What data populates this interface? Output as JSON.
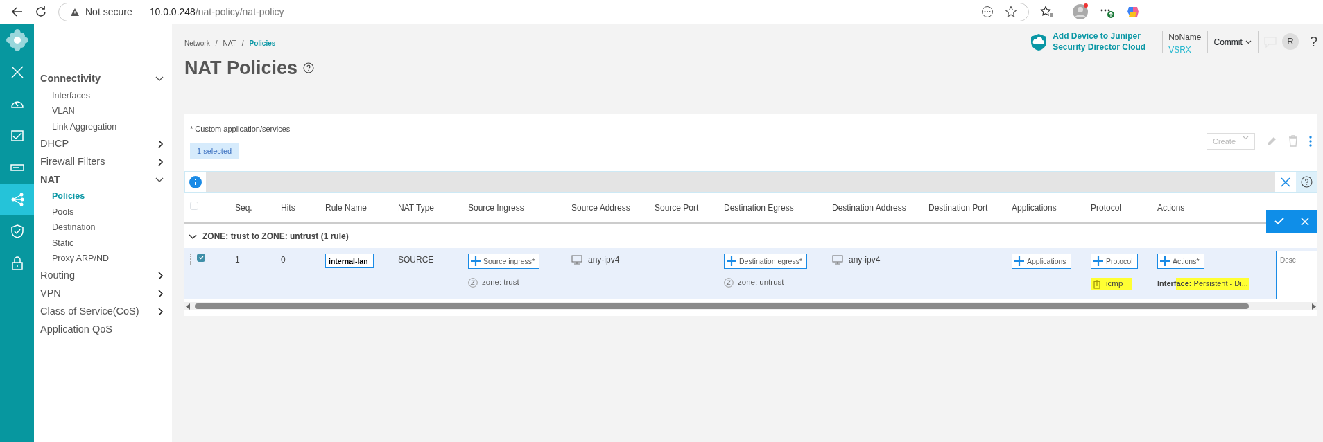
{
  "browser": {
    "security": "Not secure",
    "url_host": "10.0.0.248",
    "url_path": "/nat-policy/nat-policy"
  },
  "rail": [
    {
      "kind": "close",
      "selected": false
    },
    {
      "kind": "gauge",
      "selected": false
    },
    {
      "kind": "chart",
      "selected": false
    },
    {
      "kind": "device",
      "selected": false
    },
    {
      "kind": "network",
      "selected": true
    },
    {
      "kind": "shield",
      "selected": false
    },
    {
      "kind": "lock",
      "selected": false
    }
  ],
  "nav": [
    {
      "label": "Connectivity",
      "kind": "group",
      "expanded": true,
      "children": [
        {
          "label": "Interfaces",
          "selected": false
        },
        {
          "label": "VLAN",
          "selected": false
        },
        {
          "label": "Link Aggregation",
          "selected": false
        }
      ]
    },
    {
      "label": "DHCP",
      "kind": "group",
      "expanded": false
    },
    {
      "label": "Firewall Filters",
      "kind": "group",
      "expanded": false
    },
    {
      "label": "NAT",
      "kind": "group",
      "expanded": true,
      "children": [
        {
          "label": "Policies",
          "selected": true
        },
        {
          "label": "Pools",
          "selected": false
        },
        {
          "label": "Destination",
          "selected": false
        },
        {
          "label": "Static",
          "selected": false
        },
        {
          "label": "Proxy ARP/ND",
          "selected": false
        }
      ]
    },
    {
      "label": "Routing",
      "kind": "group",
      "expanded": false
    },
    {
      "label": "VPN",
      "kind": "group",
      "expanded": false
    },
    {
      "label": "Class of Service(CoS)",
      "kind": "group",
      "expanded": false
    },
    {
      "label": "Application QoS",
      "kind": "link"
    }
  ],
  "header": {
    "separator": "/",
    "breadcrumb": [
      {
        "label": "Network",
        "current": false
      },
      {
        "label": "NAT",
        "current": false
      },
      {
        "label": "Policies",
        "current": true
      }
    ],
    "title": "NAT Policies",
    "cloud_link": "Add Device to Juniper Security Director Cloud",
    "device_name": "NoName",
    "device_model": "VSRX",
    "commit": "Commit",
    "avatar": "R",
    "help": "?"
  },
  "card": {
    "select_all_checked": false,
    "note": "* Custom application/services",
    "selected_count": "1 selected",
    "create": {
      "label": "Create",
      "disabled": true
    },
    "columns": [
      "Seq.",
      "Hits",
      "Rule Name",
      "NAT Type",
      "Source Ingress",
      "Source Address",
      "Source Port",
      "Destination Egress",
      "Destination Address",
      "Destination Port",
      "Applications",
      "Protocol",
      "Actions"
    ],
    "group": {
      "label": "ZONE: trust to ZONE: untrust (1 rule)",
      "expanded": true
    },
    "rows": [
      {
        "checked": true,
        "seq": "1",
        "hits": "0",
        "rule_name": "internal-lan",
        "nat_type": "SOURCE",
        "source_ingress": {
          "button": "Source ingress*",
          "zone": "zone: trust"
        },
        "source_address": "any-ipv4",
        "source_port": "—",
        "destination_egress": {
          "button": "Destination egress*",
          "zone": "zone: untrust"
        },
        "destination_address": "any-ipv4",
        "destination_port": "—",
        "applications": {
          "button": "Applications"
        },
        "protocol": {
          "button": "Protocol",
          "value": "icmp"
        },
        "actions": {
          "button": "Actions*",
          "value": "**Interface:** Persistent - Di..."
        },
        "description": {
          "placeholder": "Desc"
        }
      }
    ]
  }
}
